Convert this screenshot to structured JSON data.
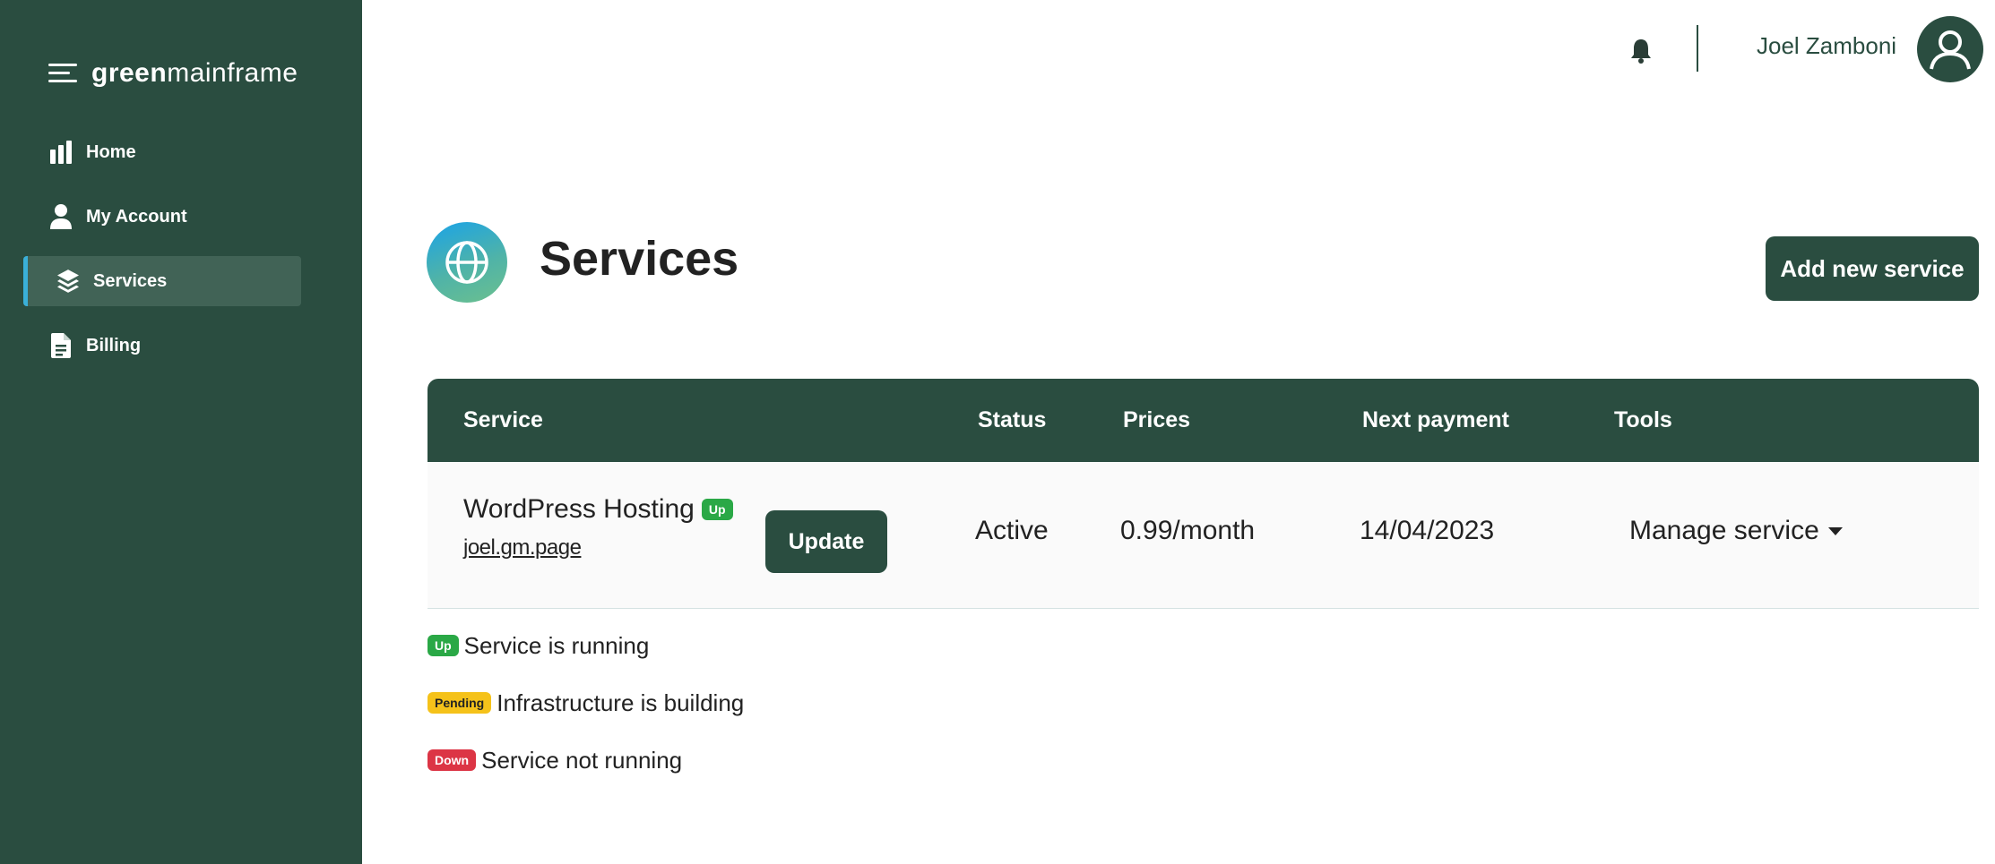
{
  "brand": {
    "bold": "green",
    "light": "mainframe"
  },
  "sidebar": {
    "items": [
      {
        "label": "Home",
        "icon": "bar-chart-icon"
      },
      {
        "label": "My Account",
        "icon": "user-icon"
      },
      {
        "label": "Services",
        "icon": "layers-icon",
        "active": true
      },
      {
        "label": "Billing",
        "icon": "document-icon"
      }
    ]
  },
  "header": {
    "user_name": "Joel Zamboni"
  },
  "page": {
    "title": "Services",
    "add_button": "Add new service"
  },
  "table": {
    "columns": [
      "Service",
      "Status",
      "Prices",
      "Next payment",
      "Tools"
    ],
    "rows": [
      {
        "service": "WordPress Hosting",
        "badge": "Up",
        "domain": "joel.gm.page",
        "update_label": "Update",
        "status": "Active",
        "price": "0.99/month",
        "next_payment": "14/04/2023",
        "tools": "Manage service"
      }
    ]
  },
  "legend": [
    {
      "badge": "Up",
      "text": "Service is running",
      "color": "#2aa846"
    },
    {
      "badge": "Pending",
      "text": "Infrastructure is building",
      "color": "#f5c21a"
    },
    {
      "badge": "Down",
      "text": "Service not running",
      "color": "#dc3545"
    }
  ],
  "colors": {
    "primary": "#2a4d40",
    "accent": "#3ab0d8"
  }
}
